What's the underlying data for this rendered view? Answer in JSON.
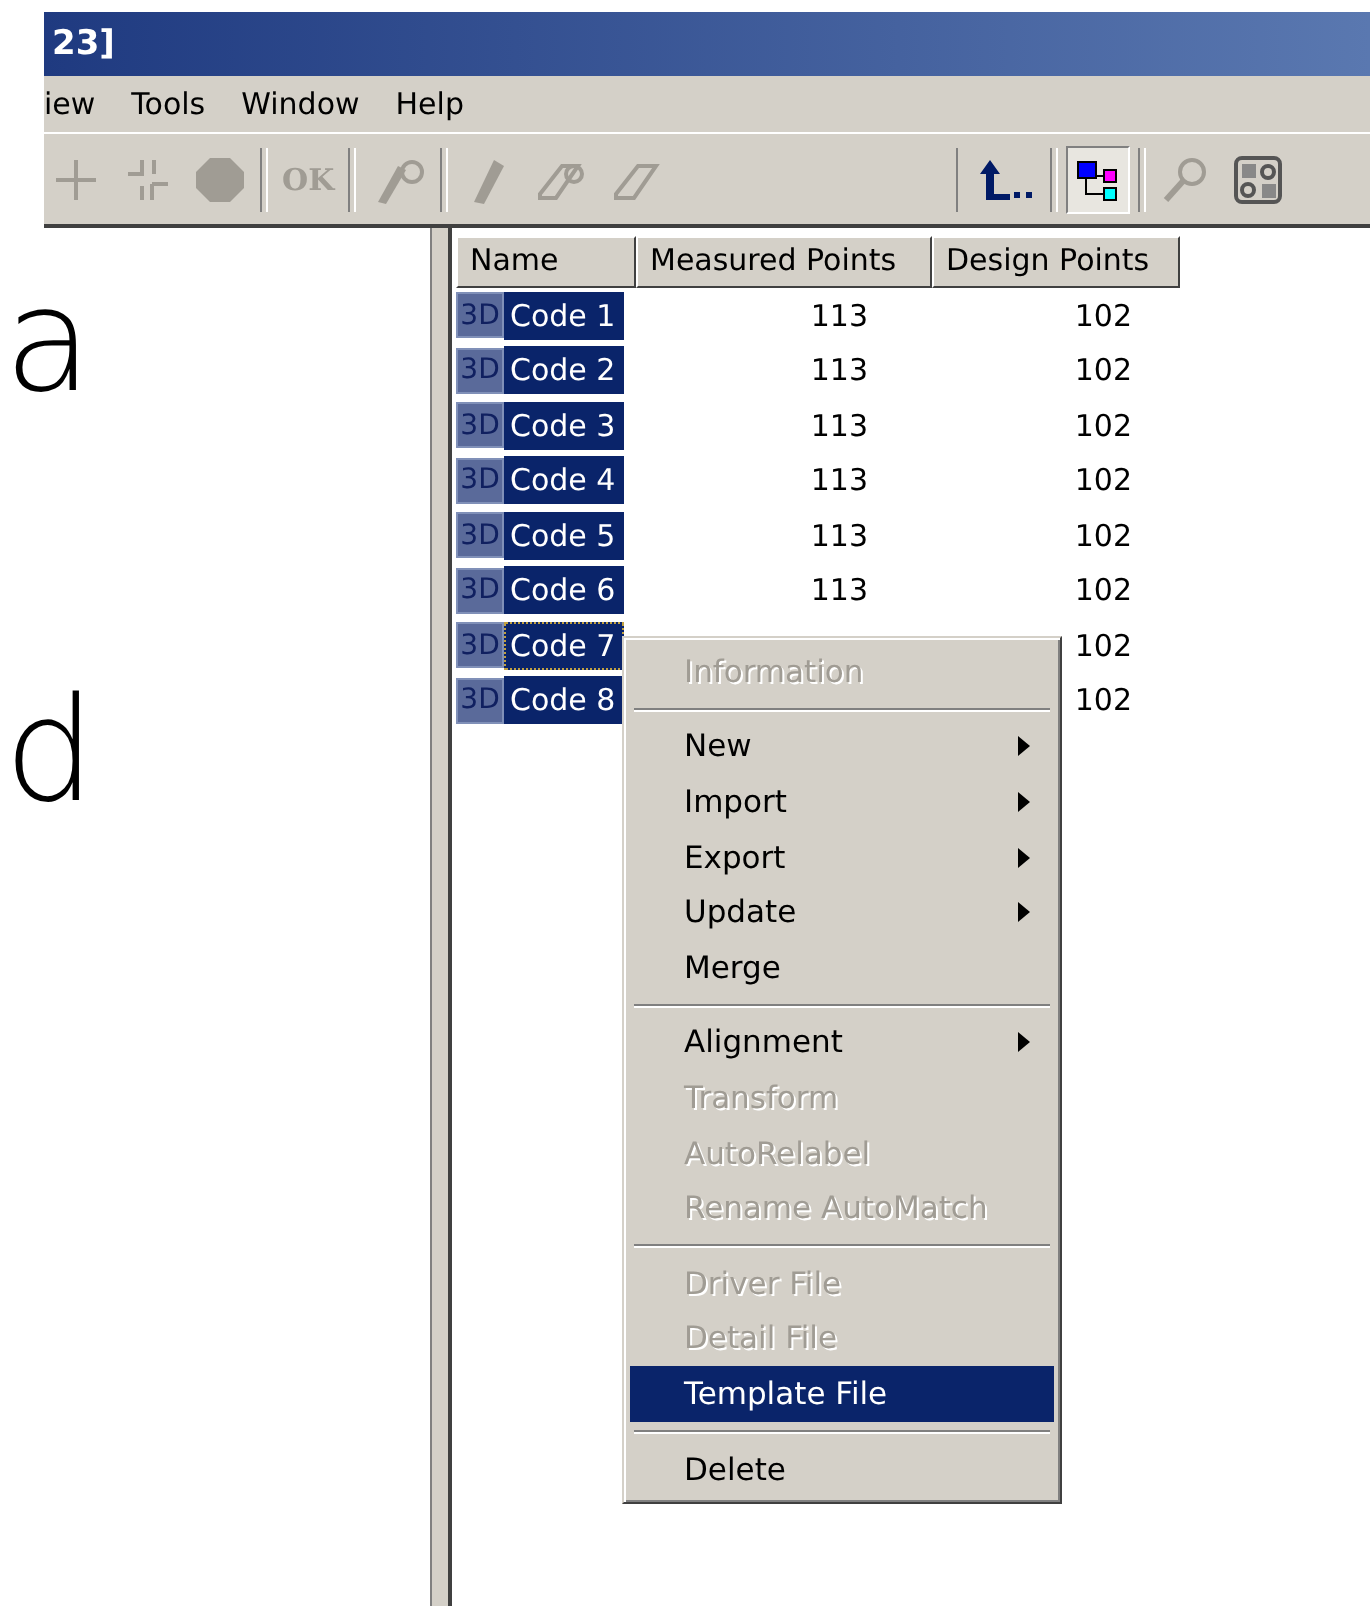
{
  "window": {
    "title": "23]"
  },
  "menu_bar": [
    {
      "label": "iew"
    },
    {
      "label": "Tools"
    },
    {
      "label": "Window"
    },
    {
      "label": "Help"
    }
  ],
  "toolbar": [
    {
      "kind": "cross",
      "disabled": true
    },
    {
      "kind": "split-cross",
      "disabled": true
    },
    {
      "kind": "hexagon",
      "disabled": true
    },
    {
      "kind": "sep"
    },
    {
      "kind": "text",
      "label": "OK",
      "disabled": true
    },
    {
      "kind": "sep"
    },
    {
      "kind": "probe",
      "disabled": true
    },
    {
      "kind": "sep"
    },
    {
      "kind": "pencil",
      "disabled": true
    },
    {
      "kind": "eraser-link",
      "disabled": true
    },
    {
      "kind": "eraser",
      "disabled": true
    },
    {
      "kind": "gap"
    },
    {
      "kind": "up-arrow"
    },
    {
      "kind": "sep"
    },
    {
      "kind": "tree",
      "pressed": true
    },
    {
      "kind": "sep"
    },
    {
      "kind": "magnifier",
      "disabled": true
    },
    {
      "kind": "binary"
    }
  ],
  "left_panel": {
    "letters": [
      "a",
      "d"
    ]
  },
  "table": {
    "columns": [
      "Name",
      "Measured Points",
      "Design Points"
    ],
    "rows": [
      {
        "badge": "3D",
        "name": "Code 1",
        "measured": "113",
        "design": "102",
        "selected": true,
        "focused": false
      },
      {
        "badge": "3D",
        "name": "Code 2",
        "measured": "113",
        "design": "102",
        "selected": true,
        "focused": false
      },
      {
        "badge": "3D",
        "name": "Code 3",
        "measured": "113",
        "design": "102",
        "selected": true,
        "focused": false
      },
      {
        "badge": "3D",
        "name": "Code 4",
        "measured": "113",
        "design": "102",
        "selected": true,
        "focused": false
      },
      {
        "badge": "3D",
        "name": "Code 5",
        "measured": "113",
        "design": "102",
        "selected": true,
        "focused": false
      },
      {
        "badge": "3D",
        "name": "Code 6",
        "measured": "113",
        "design": "102",
        "selected": true,
        "focused": false
      },
      {
        "badge": "3D",
        "name": "Code 7",
        "design": "102",
        "selected": true,
        "focused": true
      },
      {
        "badge": "3D",
        "name": "Code 8",
        "design": "102",
        "selected": true,
        "focused": false
      }
    ]
  },
  "context_menu": [
    {
      "kind": "item",
      "label": "Information",
      "disabled": true,
      "submenu": false,
      "selected": false
    },
    {
      "kind": "separator"
    },
    {
      "kind": "item",
      "label": "New",
      "disabled": false,
      "submenu": true,
      "selected": false
    },
    {
      "kind": "item",
      "label": "Import",
      "disabled": false,
      "submenu": true,
      "selected": false
    },
    {
      "kind": "item",
      "label": "Export",
      "disabled": false,
      "submenu": true,
      "selected": false
    },
    {
      "kind": "item",
      "label": "Update",
      "disabled": false,
      "submenu": true,
      "selected": false
    },
    {
      "kind": "item",
      "label": "Merge",
      "disabled": false,
      "submenu": false,
      "selected": false
    },
    {
      "kind": "separator"
    },
    {
      "kind": "item",
      "label": "Alignment",
      "disabled": false,
      "submenu": true,
      "selected": false
    },
    {
      "kind": "item",
      "label": "Transform",
      "disabled": true,
      "submenu": false,
      "selected": false
    },
    {
      "kind": "item",
      "label": "AutoRelabel",
      "disabled": true,
      "submenu": false,
      "selected": false
    },
    {
      "kind": "item",
      "label": "Rename AutoMatch",
      "disabled": true,
      "submenu": false,
      "selected": false
    },
    {
      "kind": "separator"
    },
    {
      "kind": "item",
      "label": "Driver File",
      "disabled": true,
      "submenu": false,
      "selected": false
    },
    {
      "kind": "item",
      "label": "Detail File",
      "disabled": true,
      "submenu": false,
      "selected": false
    },
    {
      "kind": "item",
      "label": "Template File",
      "disabled": false,
      "submenu": false,
      "selected": true
    },
    {
      "kind": "separator"
    },
    {
      "kind": "item",
      "label": "Delete",
      "disabled": false,
      "submenu": false,
      "selected": false
    }
  ]
}
